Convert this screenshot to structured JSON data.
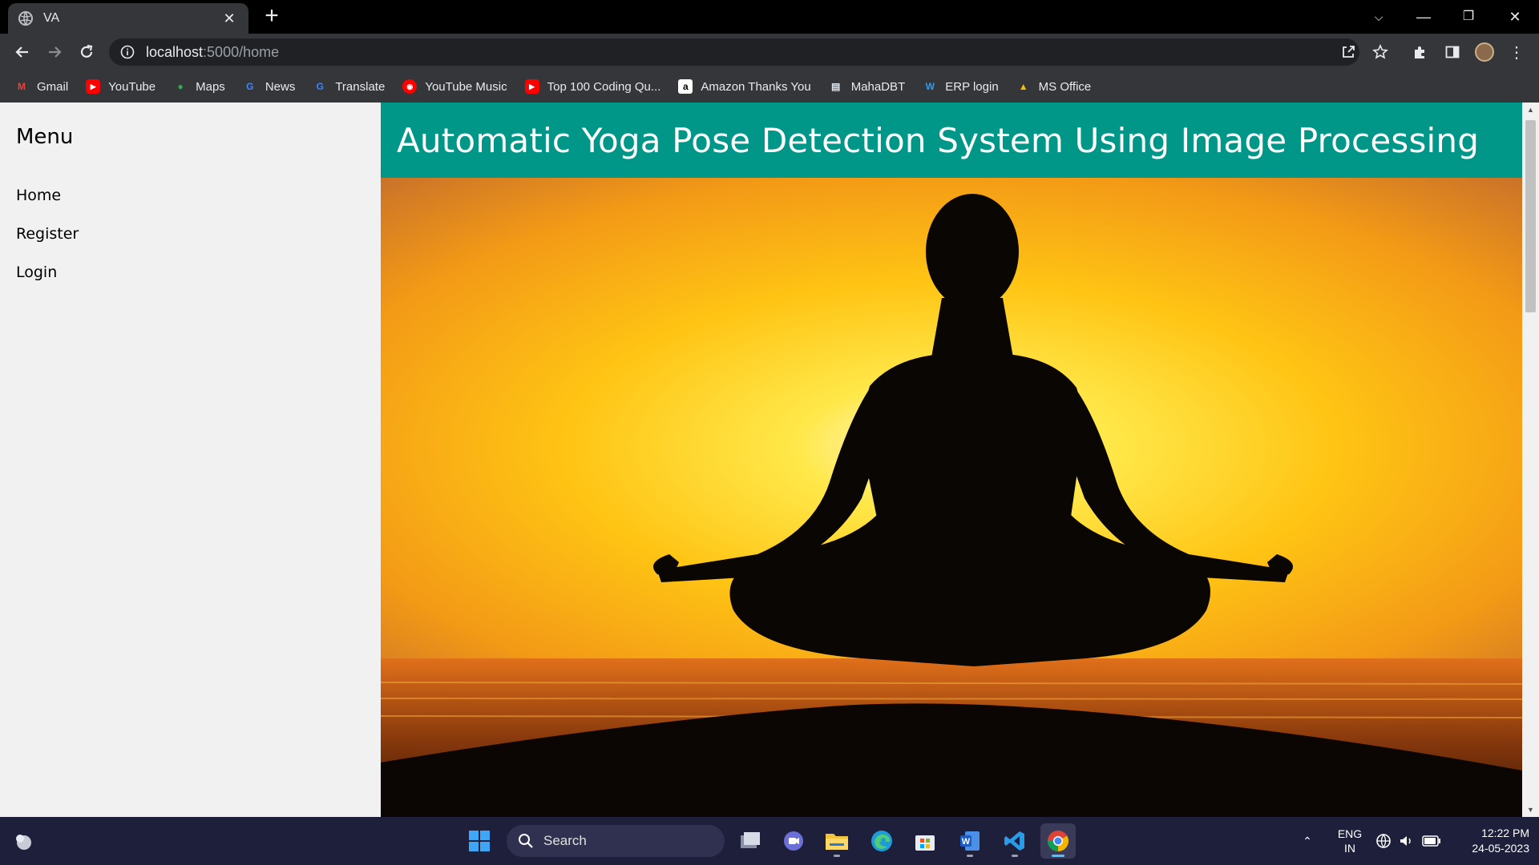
{
  "browser": {
    "tab_title": "VA",
    "url_host": "localhost",
    "url_path": ":5000/home",
    "bookmarks": [
      {
        "label": "Gmail",
        "icon": "gmail-icon",
        "color": "#ea4335"
      },
      {
        "label": "YouTube",
        "icon": "youtube-icon",
        "color": "#ff0000"
      },
      {
        "label": "Maps",
        "icon": "maps-icon",
        "color": "#34a853"
      },
      {
        "label": "News",
        "icon": "news-icon",
        "color": "#4285f4"
      },
      {
        "label": "Translate",
        "icon": "translate-icon",
        "color": "#4285f4"
      },
      {
        "label": "YouTube Music",
        "icon": "youtube-music-icon",
        "color": "#ff0000"
      },
      {
        "label": "Top 100 Coding Qu...",
        "icon": "youtube-icon",
        "color": "#ff0000"
      },
      {
        "label": "Amazon Thanks You",
        "icon": "amazon-icon",
        "color": "#ffffff"
      },
      {
        "label": "MahaDBT",
        "icon": "document-icon",
        "color": "#dfe6f0"
      },
      {
        "label": "ERP login",
        "icon": "erp-icon",
        "color": "#2a9df4"
      },
      {
        "label": "MS Office",
        "icon": "drive-icon",
        "color": "#fbbc04"
      }
    ]
  },
  "sidebar": {
    "heading": "Menu",
    "links": [
      "Home",
      "Register",
      "Login"
    ]
  },
  "main": {
    "title": "Automatic Yoga Pose Detection System Using Image Processing",
    "accent_color": "#009688",
    "hero_image": "meditation-silhouette-sunset"
  },
  "taskbar": {
    "search_placeholder": "Search",
    "language_line1": "ENG",
    "language_line2": "IN",
    "time": "12:22 PM",
    "date": "24-05-2023"
  }
}
